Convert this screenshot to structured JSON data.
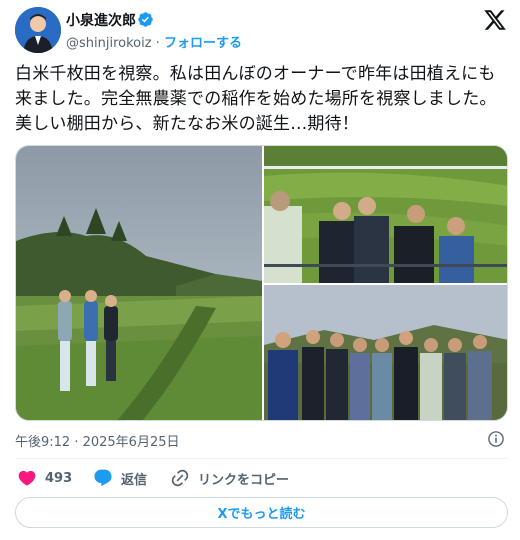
{
  "author": {
    "name": "小泉進次郎",
    "handle": "@shinjirokoiz",
    "separator": " · ",
    "follow_label": "フォローする",
    "verified_color": "#1d9bf0"
  },
  "tweet": {
    "text": "白米千枚田を視察。私は田んぼのオーナーで昨年は田植えにも来ました。完全無農薬での稲作を始めた場所を視察しました。美しい棚田から、新たなお米の誕生…期待！",
    "timestamp": "午後9:12 · 2025年6月25日"
  },
  "actions": {
    "like_count": "493",
    "reply_label": "返信",
    "copy_link_label": "リンクをコピー",
    "like_color": "#f91880",
    "reply_color": "#1d9bf0"
  },
  "more_button_label": "Xでもっと読む",
  "icons": [
    "x-logo-icon",
    "verified-badge-icon",
    "info-icon",
    "heart-icon",
    "reply-bubble-icon",
    "link-icon"
  ]
}
